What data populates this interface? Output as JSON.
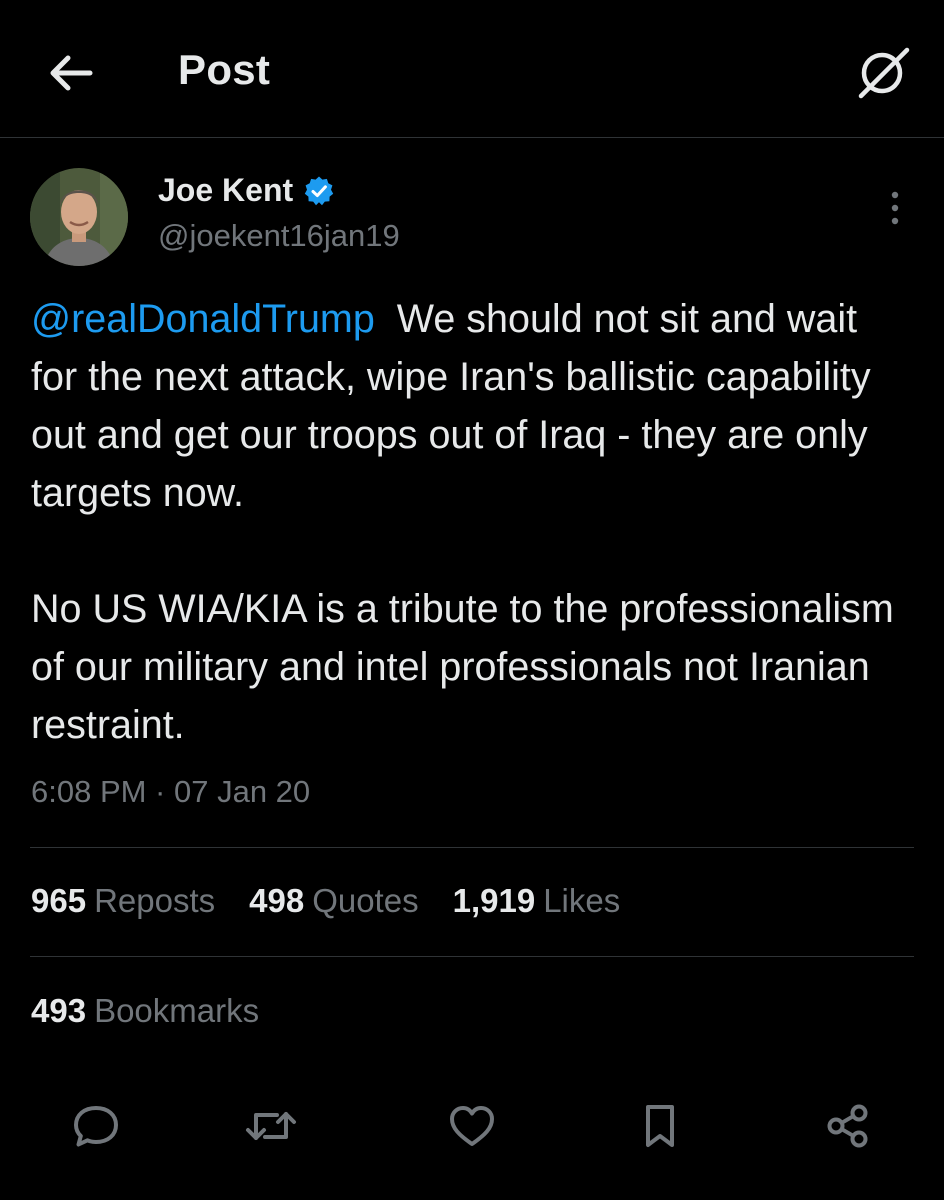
{
  "header": {
    "title": "Post",
    "back_icon": "arrow-left-icon",
    "grok_icon": "grok-icon"
  },
  "author": {
    "display_name": "Joe Kent",
    "handle": "@joekent16jan19",
    "verified": true,
    "verified_color": "#1d9bf0"
  },
  "post": {
    "mention": "@realDonaldTrump",
    "text_part1": "We should not sit and wait for the next attack, wipe Iran's ballistic capability out and get our troops out of Iraq - they are only targets now.",
    "text_part2": "No US WIA/KIA is a tribute to the professionalism of our military and intel professionals not Iranian restraint.",
    "timestamp": "6:08 PM · 07 Jan 20"
  },
  "stats": {
    "reposts_count": "965",
    "reposts_label": "Reposts",
    "quotes_count": "498",
    "quotes_label": "Quotes",
    "likes_count": "1,919",
    "likes_label": "Likes",
    "bookmarks_count": "493",
    "bookmarks_label": "Bookmarks"
  },
  "actions": [
    "reply-icon",
    "repost-icon",
    "like-icon",
    "bookmark-icon",
    "share-icon"
  ],
  "colors": {
    "background": "#000000",
    "text": "#e7e9ea",
    "muted": "#71767b",
    "accent": "#1d9bf0",
    "divider": "#2f3336"
  }
}
